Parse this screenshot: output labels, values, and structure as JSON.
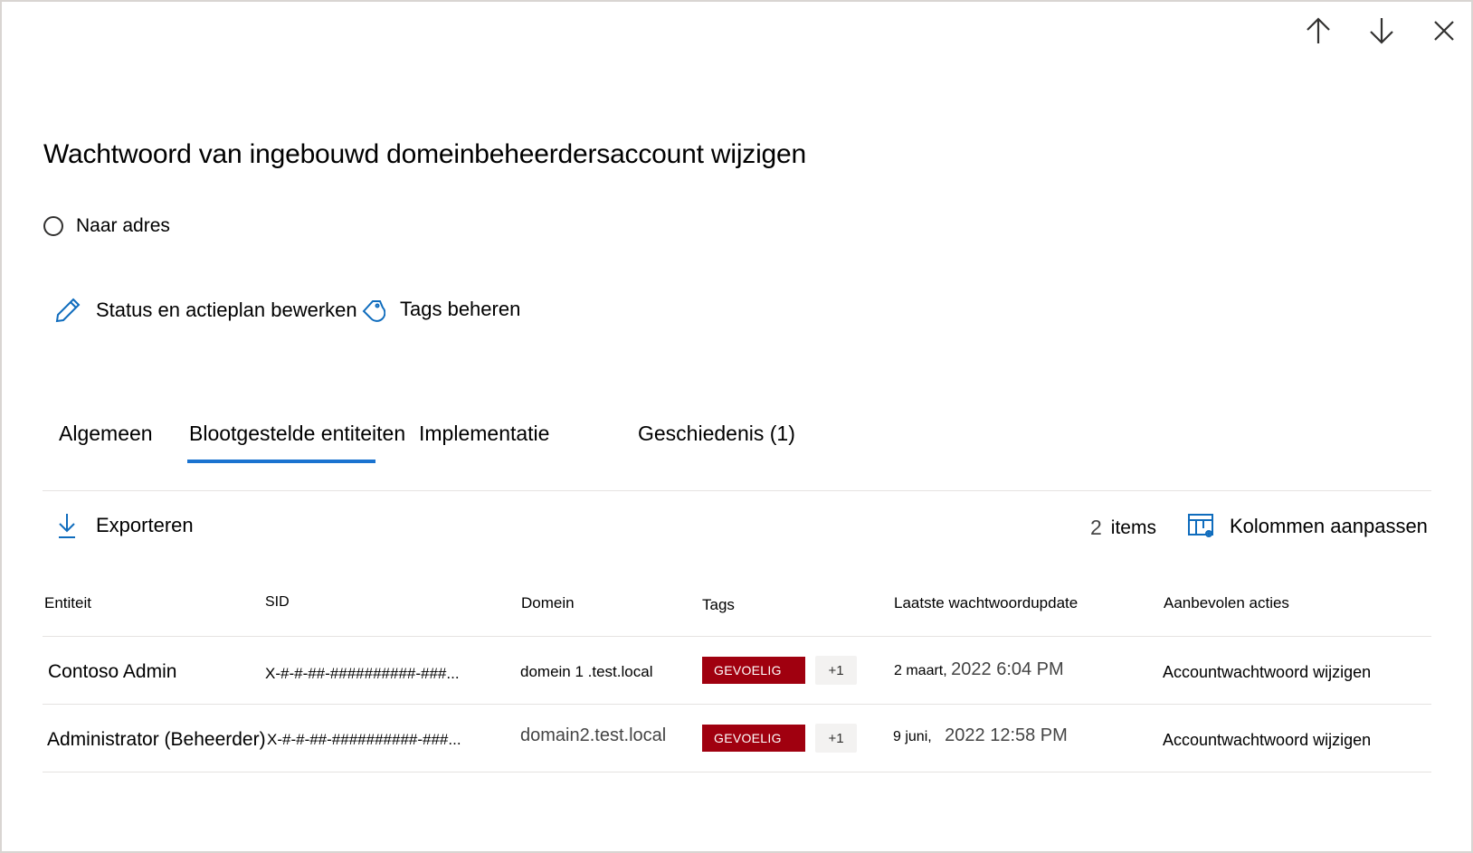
{
  "panel": {
    "nav": {
      "up_icon": "arrow-up-icon",
      "down_icon": "arrow-down-icon",
      "close_icon": "close-icon"
    },
    "title": "Wachtwoord van ingebouwd domeinbeheerdersaccount wijzigen",
    "status_radio_label": "Naar adres",
    "actions": {
      "edit_status": {
        "icon": "pencil-icon",
        "label": "Status en actieplan bewerken"
      },
      "manage_tags": {
        "icon": "tag-icon",
        "label": "Tags beheren"
      }
    },
    "tabs": [
      {
        "label": "Algemeen",
        "active": false
      },
      {
        "label": "Blootgestelde entiteiten",
        "active": true
      },
      {
        "label": "Implementatie",
        "active": false
      },
      {
        "label": "Geschiedenis (1)",
        "active": false
      }
    ],
    "accent_color": "#1a73d0"
  },
  "toolbar": {
    "export": {
      "icon": "download-icon",
      "label": "Exporteren"
    },
    "count_number": "2",
    "count_label": "items",
    "customize_columns": {
      "icon": "column-settings-icon",
      "label": "Kolommen aanpassen"
    }
  },
  "table": {
    "columns": [
      "Entiteit",
      "SID",
      "Domein",
      "Tags",
      "Laatste wachtwoordupdate",
      "Aanbevolen acties"
    ],
    "rows": [
      {
        "entity": "Contoso Admin",
        "sid": "X-#-#-##-##########-###...",
        "domain": "domein 1 .test.local",
        "tag": "GEVOELIG",
        "tag_color": "#a0000f",
        "more_tags": "+1",
        "date_part": "2 maart,",
        "time_part": "2022 6:04 PM",
        "action": "Accountwachtwoord wijzigen"
      },
      {
        "entity": "Administrator (Beheerder)",
        "sid": "X-#-#-##-##########-###...",
        "domain": "domain2.test.local",
        "tag": "GEVOELIG",
        "tag_color": "#a0000f",
        "more_tags": "+1",
        "date_part": "9 juni,",
        "time_part": "2022 12:58 PM",
        "action": "Accountwachtwoord wijzigen"
      }
    ]
  }
}
